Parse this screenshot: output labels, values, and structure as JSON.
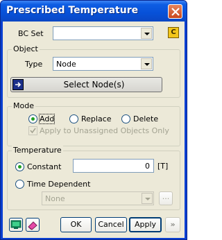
{
  "window": {
    "title": "Prescribed Temperature"
  },
  "bc_set": {
    "label": "BC Set",
    "value": "",
    "button_glyph": "C"
  },
  "object": {
    "group_label": "Object",
    "type_label": "Type",
    "type_value": "Node",
    "select_button": "Select Node(s)"
  },
  "mode": {
    "group_label": "Mode",
    "options": [
      "Add",
      "Replace",
      "Delete"
    ],
    "selected": "Add",
    "apply_unassigned": "Apply to Unassigned Objects Only"
  },
  "temperature": {
    "group_label": "Temperature",
    "constant_label": "Constant",
    "constant_value": "0",
    "unit": "[T]",
    "time_dependent_label": "Time Dependent",
    "function_value": "None",
    "browse_label": "...",
    "selected": "Constant"
  },
  "buttons": {
    "ok": "OK",
    "cancel": "Cancel",
    "apply": "Apply",
    "more": "»"
  }
}
